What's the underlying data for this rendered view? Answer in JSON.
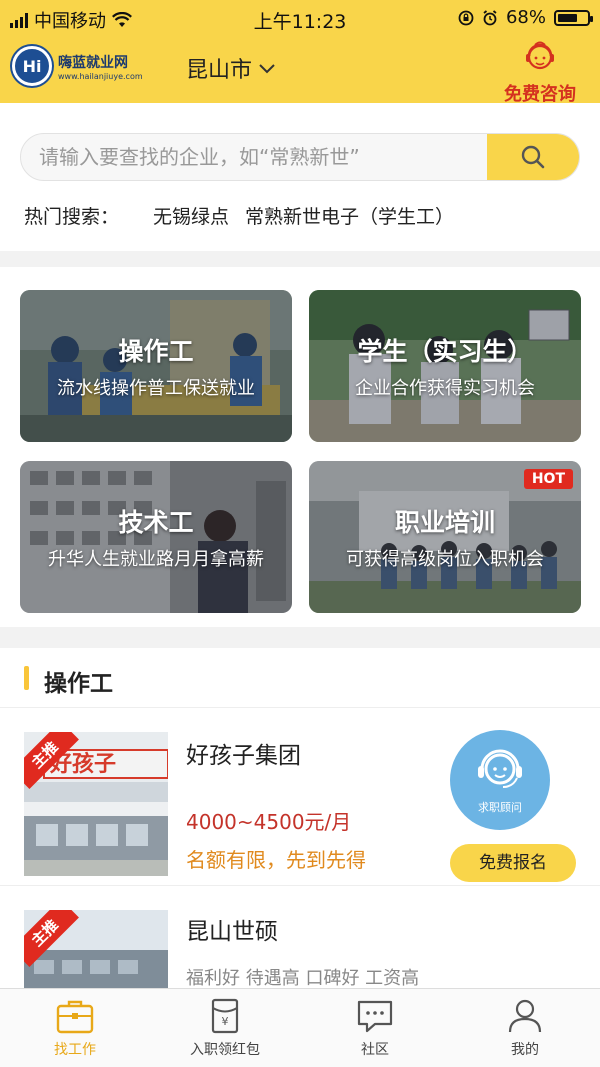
{
  "status_bar": {
    "carrier": "中国移动",
    "time": "上午11:23",
    "battery_percent": "68%",
    "battery_level": 0.68
  },
  "header": {
    "logo_text": "嗨蓝就业网",
    "logo_url_text": "www.hailanjiuye.com",
    "logo_badge": "Hi",
    "city": "昆山市",
    "consult_label": "免费咨询"
  },
  "search": {
    "placeholder": "请输入要查找的企业，如“常熟新世”",
    "hot_label": "热门搜索：",
    "hot_terms": [
      "无锡绿点",
      "常熟新世电子（学生工）"
    ]
  },
  "categories": [
    {
      "title": "操作工",
      "subtitle": "流水线操作普工保送就业",
      "badge": ""
    },
    {
      "title": "学生（实习生）",
      "subtitle": "企业合作获得实习机会",
      "badge": ""
    },
    {
      "title": "技术工",
      "subtitle": "升华人生就业路月月拿高薪",
      "badge": ""
    },
    {
      "title": "职业培训",
      "subtitle": "可获得高级岗位入职机会",
      "badge": "HOT"
    }
  ],
  "section": {
    "title": "操作工"
  },
  "jobs": [
    {
      "ribbon": "主推",
      "company": "好孩子集团",
      "salary": "4000~4500元/月",
      "note": "名额有限，先到先得",
      "advisor_label": "求职顾问",
      "apply_label": "免费报名",
      "image_sign": "好孩子"
    },
    {
      "ribbon": "主推",
      "company": "昆山世硕",
      "tags": "福利好 待遇高 口碑好 工资高"
    }
  ],
  "tabbar": {
    "items": [
      {
        "label": "找工作",
        "icon": "briefcase-icon",
        "active": true
      },
      {
        "label": "入职领红包",
        "icon": "red-envelope-icon",
        "active": false
      },
      {
        "label": "社区",
        "icon": "chat-bubble-icon",
        "active": false
      },
      {
        "label": "我的",
        "icon": "person-icon",
        "active": false
      }
    ]
  },
  "colors": {
    "brand_yellow": "#f9d54a",
    "accent_red": "#e02a1f",
    "salary_red": "#c4332a",
    "note_orange": "#e08a1e",
    "active_tab": "#e8a818"
  }
}
